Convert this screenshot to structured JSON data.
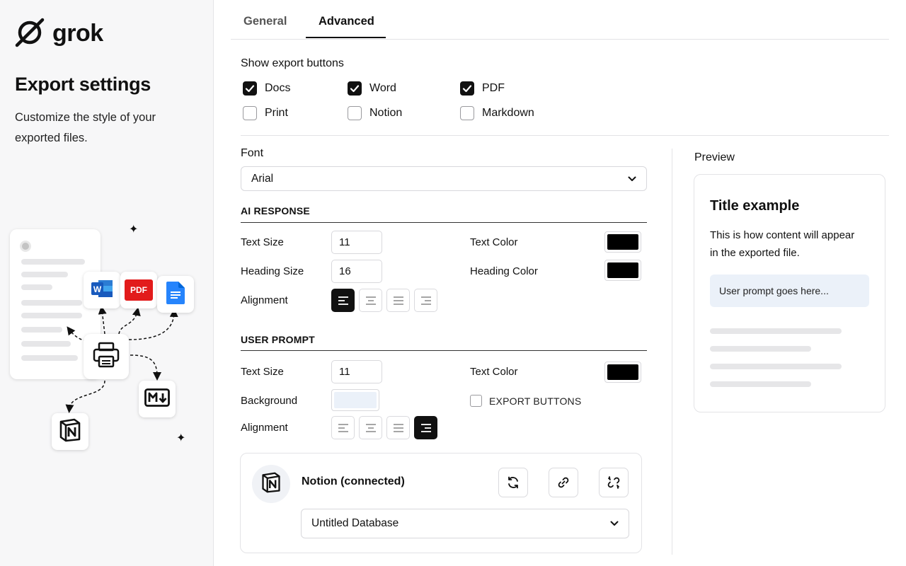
{
  "app": {
    "name": "grok"
  },
  "sidebar": {
    "title": "Export settings",
    "description": "Customize the style of your exported files.",
    "tiles": {
      "pdf_label": "PDF"
    }
  },
  "tabs": [
    {
      "label": "General",
      "active": false
    },
    {
      "label": "Advanced",
      "active": true
    }
  ],
  "export_buttons": {
    "label": "Show export buttons",
    "options": [
      {
        "label": "Docs",
        "checked": true
      },
      {
        "label": "Word",
        "checked": true
      },
      {
        "label": "PDF",
        "checked": true
      },
      {
        "label": "Print",
        "checked": false
      },
      {
        "label": "Notion",
        "checked": false
      },
      {
        "label": "Markdown",
        "checked": false
      }
    ]
  },
  "font": {
    "label": "Font",
    "value": "Arial"
  },
  "ai_response": {
    "title": "AI RESPONSE",
    "text_size_label": "Text Size",
    "text_size": "11",
    "heading_size_label": "Heading Size",
    "heading_size": "16",
    "text_color_label": "Text Color",
    "text_color": "#000000",
    "heading_color_label": "Heading Color",
    "heading_color": "#000000",
    "alignment_label": "Alignment",
    "alignment": "left"
  },
  "user_prompt": {
    "title": "USER PROMPT",
    "text_size_label": "Text Size",
    "text_size": "11",
    "background_label": "Background",
    "background": "#ebf1f9",
    "text_color_label": "Text Color",
    "text_color": "#000000",
    "export_buttons_label": "EXPORT BUTTONS",
    "export_buttons_checked": false,
    "alignment_label": "Alignment",
    "alignment": "right"
  },
  "notion": {
    "title": "Notion (connected)",
    "database": "Untitled Database"
  },
  "preview": {
    "label": "Preview",
    "title": "Title example",
    "text": "This is how content will appear in the exported file.",
    "prompt": "User prompt goes here..."
  }
}
